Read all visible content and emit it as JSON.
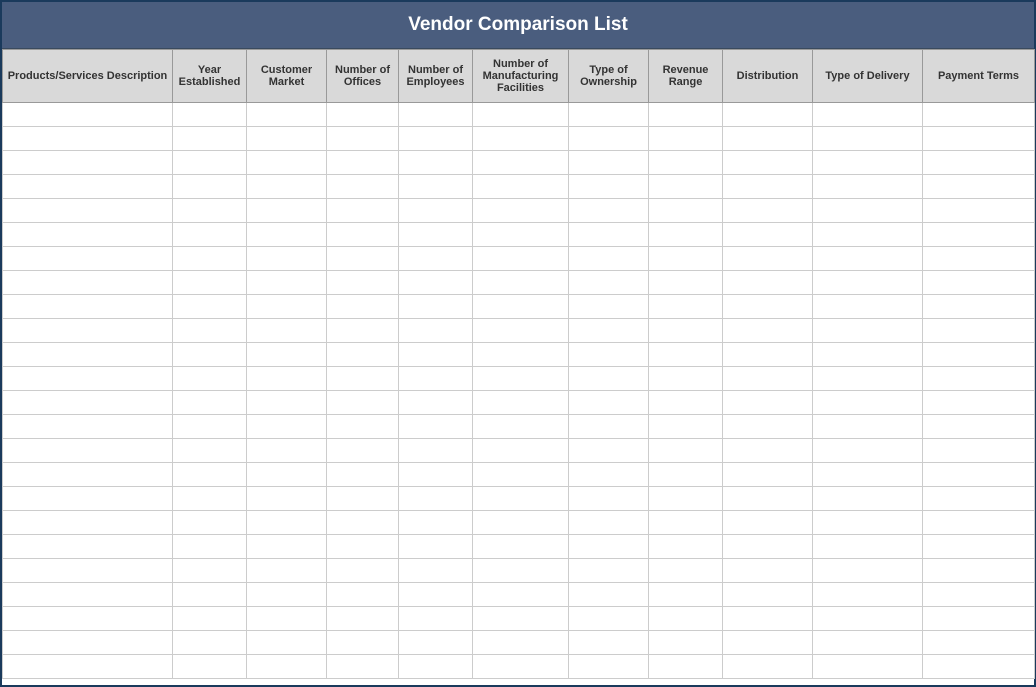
{
  "title": "Vendor Comparison List",
  "columns": [
    "Products/Services Description",
    "Year Established",
    "Customer Market",
    "Number of Offices",
    "Number of Employees",
    "Number of Manufacturing Facilities",
    "Type of Ownership",
    "Revenue Range",
    "Distribution",
    "Type of Delivery",
    "Payment Terms"
  ],
  "rowCount": 24
}
